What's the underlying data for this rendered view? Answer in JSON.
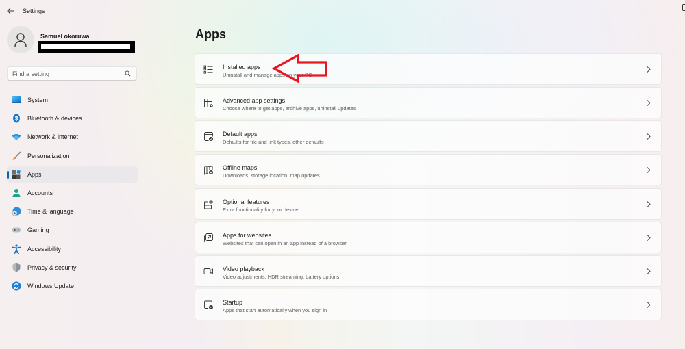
{
  "window": {
    "title": "Settings",
    "back_icon": "back-arrow-icon",
    "minimize_icon": "minimize-icon",
    "maximize_icon": "maximize-icon"
  },
  "profile": {
    "name": "Samuel okoruwa",
    "email": "[redacted]"
  },
  "search": {
    "placeholder": "Find a setting",
    "value": ""
  },
  "sidebar": {
    "items": [
      {
        "label": "System",
        "icon": "system-icon",
        "active": false
      },
      {
        "label": "Bluetooth & devices",
        "icon": "bluetooth-icon",
        "active": false
      },
      {
        "label": "Network & internet",
        "icon": "wifi-icon",
        "active": false
      },
      {
        "label": "Personalization",
        "icon": "brush-icon",
        "active": false
      },
      {
        "label": "Apps",
        "icon": "apps-icon",
        "active": true
      },
      {
        "label": "Accounts",
        "icon": "accounts-icon",
        "active": false
      },
      {
        "label": "Time & language",
        "icon": "globe-clock-icon",
        "active": false
      },
      {
        "label": "Gaming",
        "icon": "gamepad-icon",
        "active": false
      },
      {
        "label": "Accessibility",
        "icon": "accessibility-icon",
        "active": false
      },
      {
        "label": "Privacy & security",
        "icon": "shield-icon",
        "active": false
      },
      {
        "label": "Windows Update",
        "icon": "update-icon",
        "active": false
      }
    ]
  },
  "main": {
    "title": "Apps",
    "cards": [
      {
        "title": "Installed apps",
        "description": "Uninstall and manage apps on your PC",
        "icon": "list-icon"
      },
      {
        "title": "Advanced app settings",
        "description": "Choose where to get apps, archive apps, uninstall updates",
        "icon": "app-settings-icon"
      },
      {
        "title": "Default apps",
        "description": "Defaults for file and link types, other defaults",
        "icon": "default-apps-icon"
      },
      {
        "title": "Offline maps",
        "description": "Downloads, storage location, map updates",
        "icon": "map-download-icon"
      },
      {
        "title": "Optional features",
        "description": "Extra functionality for your device",
        "icon": "add-grid-icon"
      },
      {
        "title": "Apps for websites",
        "description": "Websites that can open in an app instead of a browser",
        "icon": "open-in-app-icon"
      },
      {
        "title": "Video playback",
        "description": "Video adjustments, HDR streaming, battery options",
        "icon": "video-icon"
      },
      {
        "title": "Startup",
        "description": "Apps that start automatically when you sign in",
        "icon": "startup-icon"
      }
    ]
  },
  "annotation": {
    "arrow_color": "#e8141e",
    "points_to": "Installed apps"
  },
  "colors": {
    "accent": "#0067c0"
  }
}
